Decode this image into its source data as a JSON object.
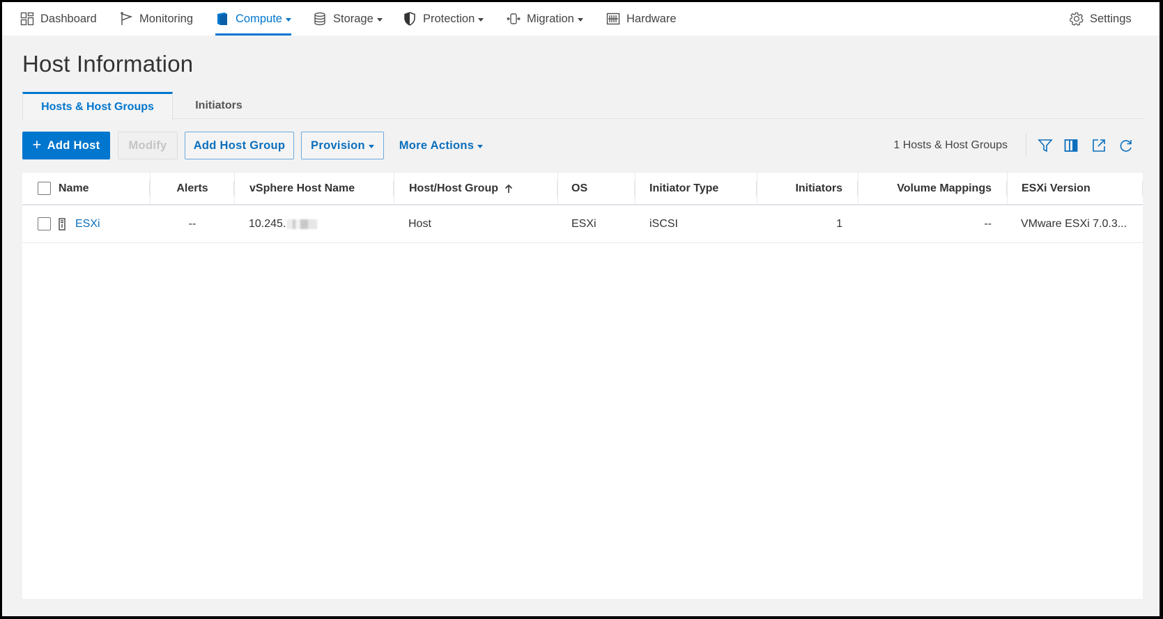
{
  "nav": {
    "items": [
      {
        "label": "Dashboard",
        "icon": "dashboard-grid-icon",
        "dropdown": false,
        "active": false
      },
      {
        "label": "Monitoring",
        "icon": "flag-icon",
        "dropdown": false,
        "active": false
      },
      {
        "label": "Compute",
        "icon": "compute-book-icon",
        "dropdown": true,
        "active": true
      },
      {
        "label": "Storage",
        "icon": "database-icon",
        "dropdown": true,
        "active": false
      },
      {
        "label": "Protection",
        "icon": "shield-icon",
        "dropdown": true,
        "active": false
      },
      {
        "label": "Migration",
        "icon": "migration-icon",
        "dropdown": true,
        "active": false
      },
      {
        "label": "Hardware",
        "icon": "hardware-rack-icon",
        "dropdown": false,
        "active": false
      }
    ],
    "settings": {
      "label": "Settings",
      "icon": "gear-icon"
    }
  },
  "page": {
    "title": "Host Information",
    "tabs": [
      {
        "label": "Hosts & Host Groups",
        "active": true
      },
      {
        "label": "Initiators",
        "active": false
      }
    ]
  },
  "toolbar": {
    "add_host": "Add Host",
    "add_host_icon": "+",
    "modify": "Modify",
    "add_host_group": "Add Host Group",
    "provision": "Provision",
    "more_actions": "More Actions",
    "count_text": "1 Hosts & Host Groups",
    "icons": [
      "filter-icon",
      "columns-icon",
      "export-icon",
      "refresh-icon"
    ]
  },
  "table": {
    "columns": [
      {
        "label": "Name"
      },
      {
        "label": "Alerts"
      },
      {
        "label": "vSphere Host Name"
      },
      {
        "label": "Host/Host Group",
        "sort": "ascending"
      },
      {
        "label": "OS"
      },
      {
        "label": "Initiator Type"
      },
      {
        "label": "Initiators"
      },
      {
        "label": "Volume Mappings"
      },
      {
        "label": "ESXi Version"
      }
    ],
    "rows": [
      {
        "name": "ESXi",
        "type_icon": "host-server-icon",
        "alerts": "--",
        "vsphere_host_name": "10.245.",
        "vsphere_host_name_redacted": true,
        "host_or_group": "Host",
        "os": "ESXi",
        "initiator_type": "iSCSI",
        "initiators": "1",
        "volume_mappings": "--",
        "esxi_version": "VMware ESXi 7.0.3..."
      }
    ]
  },
  "colors": {
    "accent": "#0076ce",
    "link": "#0b6fbd",
    "page_bg": "#f2f2f2",
    "panel_bg": "#ffffff"
  }
}
